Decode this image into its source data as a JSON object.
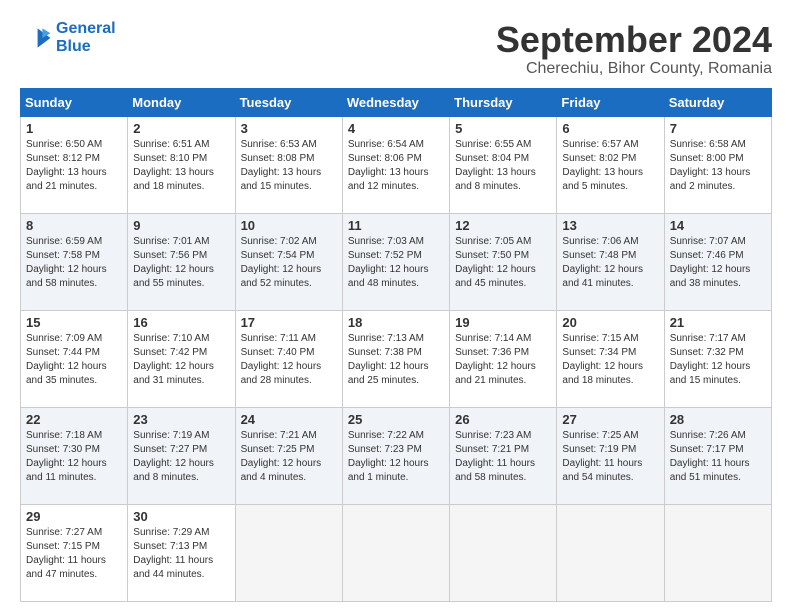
{
  "logo": {
    "line1": "General",
    "line2": "Blue"
  },
  "title": "September 2024",
  "subtitle": "Cherechiu, Bihor County, Romania",
  "weekdays": [
    "Sunday",
    "Monday",
    "Tuesday",
    "Wednesday",
    "Thursday",
    "Friday",
    "Saturday"
  ],
  "weeks": [
    [
      {
        "day": "1",
        "sunrise": "6:50 AM",
        "sunset": "8:12 PM",
        "daylight": "13 hours and 21 minutes."
      },
      {
        "day": "2",
        "sunrise": "6:51 AM",
        "sunset": "8:10 PM",
        "daylight": "13 hours and 18 minutes."
      },
      {
        "day": "3",
        "sunrise": "6:53 AM",
        "sunset": "8:08 PM",
        "daylight": "13 hours and 15 minutes."
      },
      {
        "day": "4",
        "sunrise": "6:54 AM",
        "sunset": "8:06 PM",
        "daylight": "13 hours and 12 minutes."
      },
      {
        "day": "5",
        "sunrise": "6:55 AM",
        "sunset": "8:04 PM",
        "daylight": "13 hours and 8 minutes."
      },
      {
        "day": "6",
        "sunrise": "6:57 AM",
        "sunset": "8:02 PM",
        "daylight": "13 hours and 5 minutes."
      },
      {
        "day": "7",
        "sunrise": "6:58 AM",
        "sunset": "8:00 PM",
        "daylight": "13 hours and 2 minutes."
      }
    ],
    [
      {
        "day": "8",
        "sunrise": "6:59 AM",
        "sunset": "7:58 PM",
        "daylight": "12 hours and 58 minutes."
      },
      {
        "day": "9",
        "sunrise": "7:01 AM",
        "sunset": "7:56 PM",
        "daylight": "12 hours and 55 minutes."
      },
      {
        "day": "10",
        "sunrise": "7:02 AM",
        "sunset": "7:54 PM",
        "daylight": "12 hours and 52 minutes."
      },
      {
        "day": "11",
        "sunrise": "7:03 AM",
        "sunset": "7:52 PM",
        "daylight": "12 hours and 48 minutes."
      },
      {
        "day": "12",
        "sunrise": "7:05 AM",
        "sunset": "7:50 PM",
        "daylight": "12 hours and 45 minutes."
      },
      {
        "day": "13",
        "sunrise": "7:06 AM",
        "sunset": "7:48 PM",
        "daylight": "12 hours and 41 minutes."
      },
      {
        "day": "14",
        "sunrise": "7:07 AM",
        "sunset": "7:46 PM",
        "daylight": "12 hours and 38 minutes."
      }
    ],
    [
      {
        "day": "15",
        "sunrise": "7:09 AM",
        "sunset": "7:44 PM",
        "daylight": "12 hours and 35 minutes."
      },
      {
        "day": "16",
        "sunrise": "7:10 AM",
        "sunset": "7:42 PM",
        "daylight": "12 hours and 31 minutes."
      },
      {
        "day": "17",
        "sunrise": "7:11 AM",
        "sunset": "7:40 PM",
        "daylight": "12 hours and 28 minutes."
      },
      {
        "day": "18",
        "sunrise": "7:13 AM",
        "sunset": "7:38 PM",
        "daylight": "12 hours and 25 minutes."
      },
      {
        "day": "19",
        "sunrise": "7:14 AM",
        "sunset": "7:36 PM",
        "daylight": "12 hours and 21 minutes."
      },
      {
        "day": "20",
        "sunrise": "7:15 AM",
        "sunset": "7:34 PM",
        "daylight": "12 hours and 18 minutes."
      },
      {
        "day": "21",
        "sunrise": "7:17 AM",
        "sunset": "7:32 PM",
        "daylight": "12 hours and 15 minutes."
      }
    ],
    [
      {
        "day": "22",
        "sunrise": "7:18 AM",
        "sunset": "7:30 PM",
        "daylight": "12 hours and 11 minutes."
      },
      {
        "day": "23",
        "sunrise": "7:19 AM",
        "sunset": "7:27 PM",
        "daylight": "12 hours and 8 minutes."
      },
      {
        "day": "24",
        "sunrise": "7:21 AM",
        "sunset": "7:25 PM",
        "daylight": "12 hours and 4 minutes."
      },
      {
        "day": "25",
        "sunrise": "7:22 AM",
        "sunset": "7:23 PM",
        "daylight": "12 hours and 1 minute."
      },
      {
        "day": "26",
        "sunrise": "7:23 AM",
        "sunset": "7:21 PM",
        "daylight": "11 hours and 58 minutes."
      },
      {
        "day": "27",
        "sunrise": "7:25 AM",
        "sunset": "7:19 PM",
        "daylight": "11 hours and 54 minutes."
      },
      {
        "day": "28",
        "sunrise": "7:26 AM",
        "sunset": "7:17 PM",
        "daylight": "11 hours and 51 minutes."
      }
    ],
    [
      {
        "day": "29",
        "sunrise": "7:27 AM",
        "sunset": "7:15 PM",
        "daylight": "11 hours and 47 minutes."
      },
      {
        "day": "30",
        "sunrise": "7:29 AM",
        "sunset": "7:13 PM",
        "daylight": "11 hours and 44 minutes."
      },
      null,
      null,
      null,
      null,
      null
    ]
  ]
}
